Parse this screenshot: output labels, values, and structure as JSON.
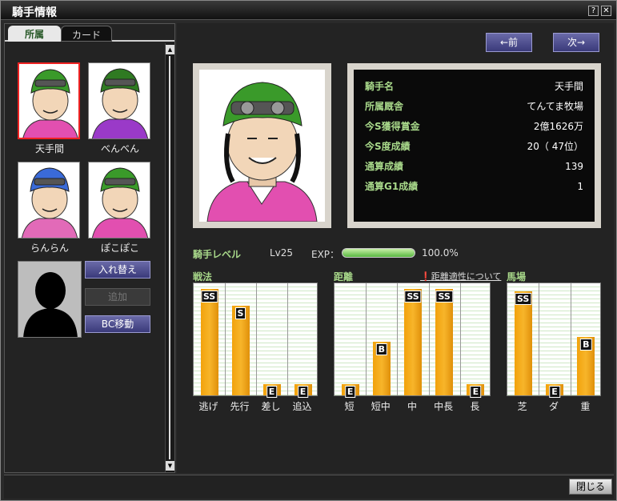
{
  "window": {
    "title": "騎手情報"
  },
  "tabs": [
    {
      "label": "所属"
    },
    {
      "label": "カード"
    }
  ],
  "jockeys": [
    {
      "name": "天手間",
      "helmet": "#3a9a2a",
      "silks": "#e24fb0",
      "selected": true
    },
    {
      "name": "べんべん",
      "helmet": "#2f7a22",
      "silks": "#9a3ac8",
      "selected": false
    },
    {
      "name": "らんらん",
      "helmet": "#3a6ad8",
      "silks": "#e26ab8",
      "selected": false
    },
    {
      "name": "ぽこぽこ",
      "helmet": "#3a9a2a",
      "silks": "#e24fb0",
      "selected": false
    }
  ],
  "side_buttons": {
    "swap": "入れ替え",
    "add": "追加",
    "bc_move": "BC移動"
  },
  "nav": {
    "prev": "←前",
    "next": "次→"
  },
  "info": [
    {
      "label": "騎手名",
      "value": "天手間"
    },
    {
      "label": "所属厩舎",
      "value": "てんてま牧場"
    },
    {
      "label": "今S獲得賞金",
      "value": "2億1626万"
    },
    {
      "label": "今S度成績",
      "value": "20（ 47位）"
    },
    {
      "label": "通算成績",
      "value": "139"
    },
    {
      "label": "通算G1成績",
      "value": "1"
    }
  ],
  "level": {
    "title": "騎手レベル",
    "value": "Lv25",
    "exp_label": "EXP：",
    "exp_percent_text": "100.0%",
    "exp_fraction": 1.0
  },
  "chart_data": [
    {
      "type": "bar",
      "title": "戦法",
      "categories": [
        "逃げ",
        "先行",
        "差し",
        "追込"
      ],
      "grades": [
        "SS",
        "S",
        "E",
        "E"
      ],
      "values": [
        95,
        80,
        10,
        8
      ]
    },
    {
      "type": "bar",
      "title": "距離",
      "note": "距離適性について",
      "categories": [
        "短",
        "短中",
        "中",
        "中長",
        "長"
      ],
      "grades": [
        "E",
        "B",
        "SS",
        "SS",
        "E"
      ],
      "values": [
        8,
        48,
        95,
        95,
        8
      ]
    },
    {
      "type": "bar",
      "title": "馬場",
      "categories": [
        "芝",
        "ダ",
        "重"
      ],
      "grades": [
        "SS",
        "E",
        "B"
      ],
      "values": [
        93,
        8,
        52
      ]
    }
  ],
  "footer": {
    "close": "閉じる"
  },
  "colors": {
    "accent_green": "#a8d88a",
    "bar_orange": "#f2a20c",
    "button_blue": "#4a4a8a"
  }
}
